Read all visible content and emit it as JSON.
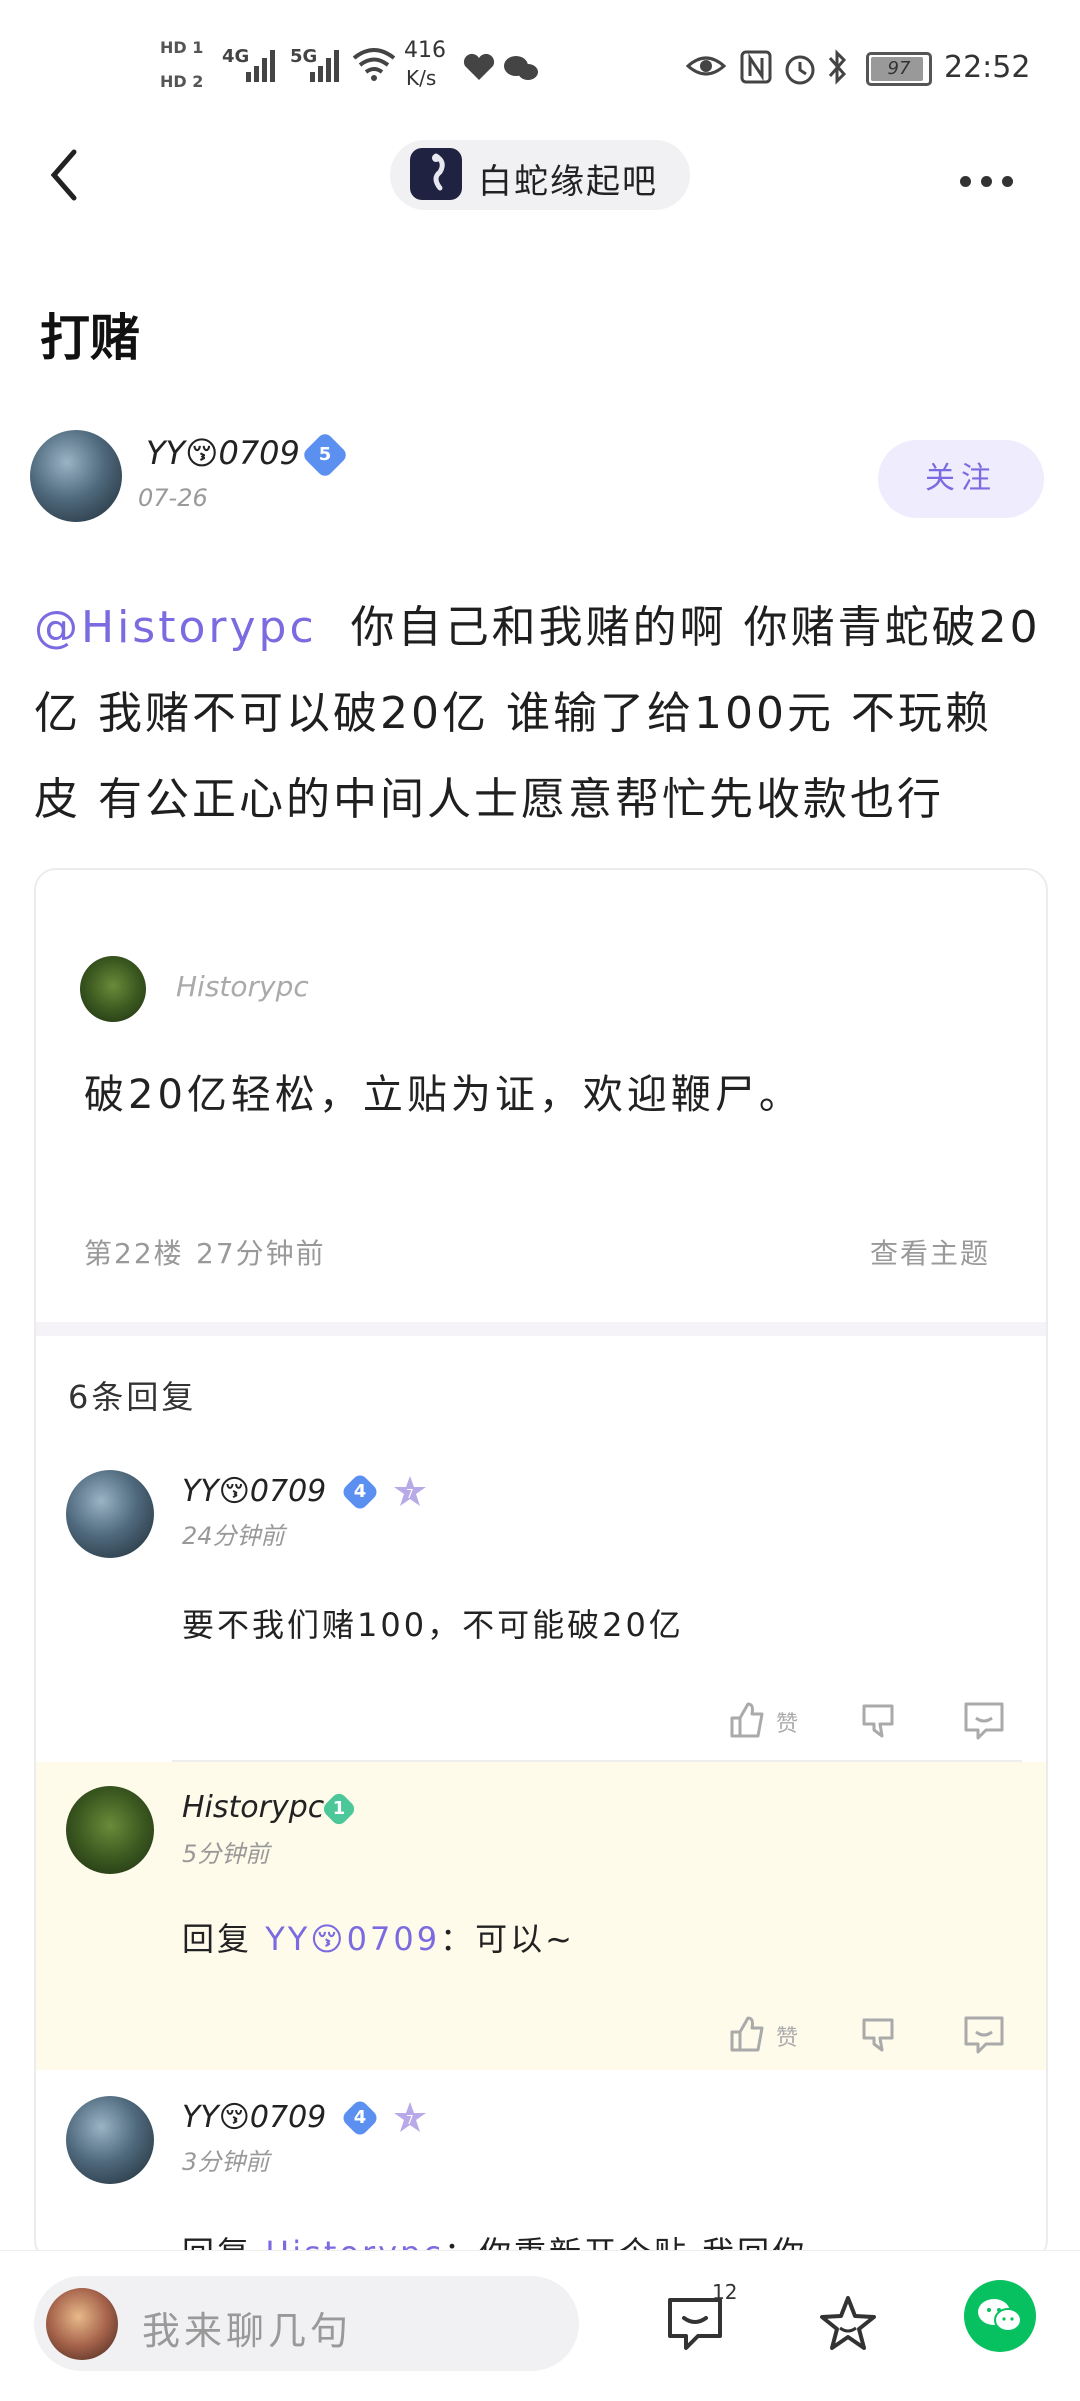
{
  "status_bar": {
    "sim1": "HD 1",
    "sim2": "HD 2",
    "net1": "4G",
    "net2": "5G",
    "speed_value": "416",
    "speed_unit": "K/s",
    "battery": "97",
    "time": "22:52"
  },
  "nav": {
    "forum_name": "白蛇缘起吧"
  },
  "post": {
    "title": "打赌",
    "author": "YY😚0709",
    "author_level": "5",
    "date": "07-26",
    "follow_label": "关注",
    "mention": "@Historypc",
    "body_line1": "你自己和我赌的啊 你赌青蛇破20",
    "body_line2": "亿 我赌不可以破20亿 谁输了给100元 不玩赖",
    "body_line3": "皮 有公正心的中间人士愿意帮忙先收款也行"
  },
  "quote": {
    "author": "Historypc",
    "text": "破20亿轻松，立贴为证，欢迎鞭尸。",
    "floor": "第22楼",
    "time": "27分钟前",
    "view_topic": "查看主题"
  },
  "replies_header": "6条回复",
  "replies": [
    {
      "author": "YY😚0709",
      "level": "4",
      "badge2": "7",
      "time": "24分钟前",
      "text": "要不我们赌100，不可能破20亿",
      "like_label": "赞"
    },
    {
      "author": "Historypc",
      "level": "1",
      "time": "5分钟前",
      "reply_prefix": "回复",
      "reply_to": "YY😚0709",
      "text": "：可以~",
      "like_label": "赞"
    },
    {
      "author": "YY😚0709",
      "level": "4",
      "badge2": "7",
      "time": "3分钟前",
      "reply_prefix": "回复",
      "reply_to": "Historypc",
      "text": "：你重新开个贴 我回你"
    }
  ],
  "bottom_bar": {
    "input_placeholder": "我来聊几句",
    "comment_count": "12"
  },
  "colors": {
    "accent": "#7b6be0",
    "highlight_bg": "#fffbea",
    "wechat_green": "#07c160"
  }
}
